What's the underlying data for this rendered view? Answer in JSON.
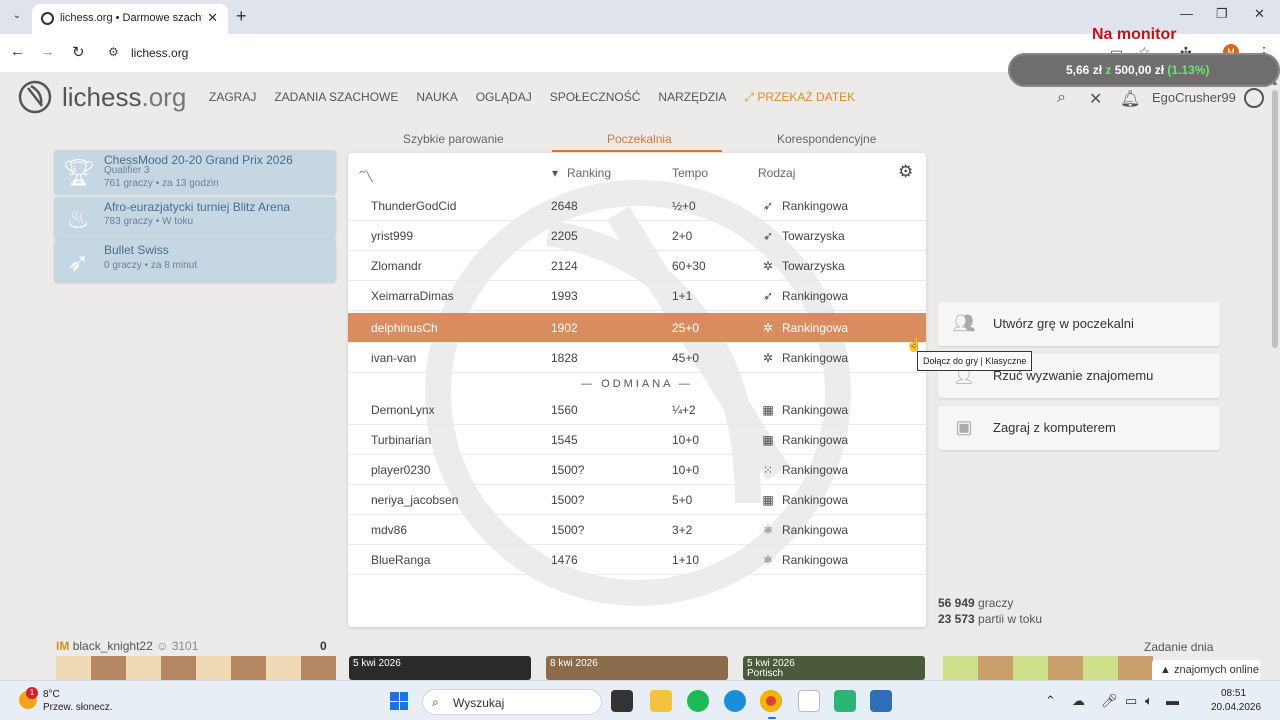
{
  "browser": {
    "tab_title": "lichess.org • Darmowe szachy o",
    "url": "lichess.org",
    "new_tab_glyph": "+",
    "close_glyph": "✕"
  },
  "overlay": {
    "monitor_label": "Na monitor",
    "stock_value": "5,66 zł",
    "stock_sep": " z ",
    "stock_total": "500,00 zł",
    "stock_pct": "(1.13%)"
  },
  "site": {
    "name_main": "lichess",
    "name_tld": ".org",
    "nav": [
      "ZAGRAJ",
      "ZADANIA SZACHOWE",
      "NAUKA",
      "OGLĄDAJ",
      "SPOŁECZNOŚĆ",
      "NARZĘDZIA"
    ],
    "donate": "PRZEKAŻ DATEK",
    "username": "EgoCrusher99"
  },
  "lobby_tabs": [
    "Szybkie parowanie",
    "Poczekalnia",
    "Korespondencyjne"
  ],
  "tournaments": [
    {
      "name": "ChessMood 20-20 Grand Prix 2026",
      "sub": "Qualifier 3",
      "meta": "761 graczy • za 13 godzin",
      "icon": "trophy-icon"
    },
    {
      "name": "Afro-eurazjatycki turniej Blitz Arena",
      "sub": "",
      "meta": "783 graczy • W toku",
      "icon": "fire-icon"
    },
    {
      "name": "Bullet Swiss",
      "sub": "",
      "meta": "0 graczy • za 8 minut",
      "icon": "bullet-icon"
    }
  ],
  "seeks": {
    "columns": {
      "rating": "Ranking",
      "time": "Tempo",
      "mode": "Rodzaj"
    },
    "divider": "— ODMIANA —",
    "rows": [
      {
        "player": "ThunderGodCid",
        "rating": "2648",
        "time": "½+0",
        "icon": "bullet",
        "mode": "Rankingowa"
      },
      {
        "player": "yrist999",
        "rating": "2205",
        "time": "2+0",
        "icon": "bullet",
        "mode": "Towarzyska"
      },
      {
        "player": "Zlomandr",
        "rating": "2124",
        "time": "60+30",
        "icon": "classical",
        "mode": "Towarzyska"
      },
      {
        "player": "XeimarraDimas",
        "rating": "1993",
        "time": "1+1",
        "icon": "bullet",
        "mode": "Rankingowa"
      },
      {
        "player": "delphinusCh",
        "rating": "1902",
        "time": "25+0",
        "icon": "classical",
        "mode": "Rankingowa"
      },
      {
        "player": "ivan-van",
        "rating": "1828",
        "time": "45+0",
        "icon": "classical",
        "mode": "Rankingowa"
      }
    ],
    "variant_rows": [
      {
        "player": "DemonLynx",
        "rating": "1560",
        "time": "¼+2",
        "icon": "chess960",
        "mode": "Rankingowa"
      },
      {
        "player": "Turbinarian",
        "rating": "1545",
        "time": "10+0",
        "icon": "chess960",
        "mode": "Rankingowa"
      },
      {
        "player": "player0230",
        "rating": "1500?",
        "time": "10+0",
        "icon": "horde",
        "mode": "Rankingowa"
      },
      {
        "player": "neriya_jacobsen",
        "rating": "1500?",
        "time": "5+0",
        "icon": "chess960",
        "mode": "Rankingowa"
      },
      {
        "player": "mdv86",
        "rating": "1500?",
        "time": "3+2",
        "icon": "atomic",
        "mode": "Rankingowa"
      },
      {
        "player": "BlueRanga",
        "rating": "1476",
        "time": "1+10",
        "icon": "atomic",
        "mode": "Rankingowa"
      }
    ],
    "tooltip": "Dołącz do gry | Klasyczne"
  },
  "actions": [
    "Utwórz grę w poczekalni",
    "Rzuć wyzwanie znajomemu",
    "Zagraj z komputerem"
  ],
  "stats": {
    "players_num": "56 949",
    "players_label": " graczy",
    "games_num": "23 573",
    "games_label": " partii w toku"
  },
  "bottom": {
    "tv_title": "IM",
    "tv_player": "black_knight22",
    "tv_rating": "3101",
    "tv_score": "0",
    "blog_dates": [
      "5 kwi 2026",
      "8 kwi 2026",
      "5 kwi 2026"
    ],
    "blog_title_fragment": "Portisch",
    "puzzle_label": "Zadanie dnia",
    "friends": "znajomych online"
  },
  "taskbar": {
    "temp": "8°C",
    "weather": "Przew. słonecz.",
    "search_placeholder": "Wyszukaj",
    "time": "08:51",
    "date": "20.04.2026",
    "badge": "1"
  }
}
